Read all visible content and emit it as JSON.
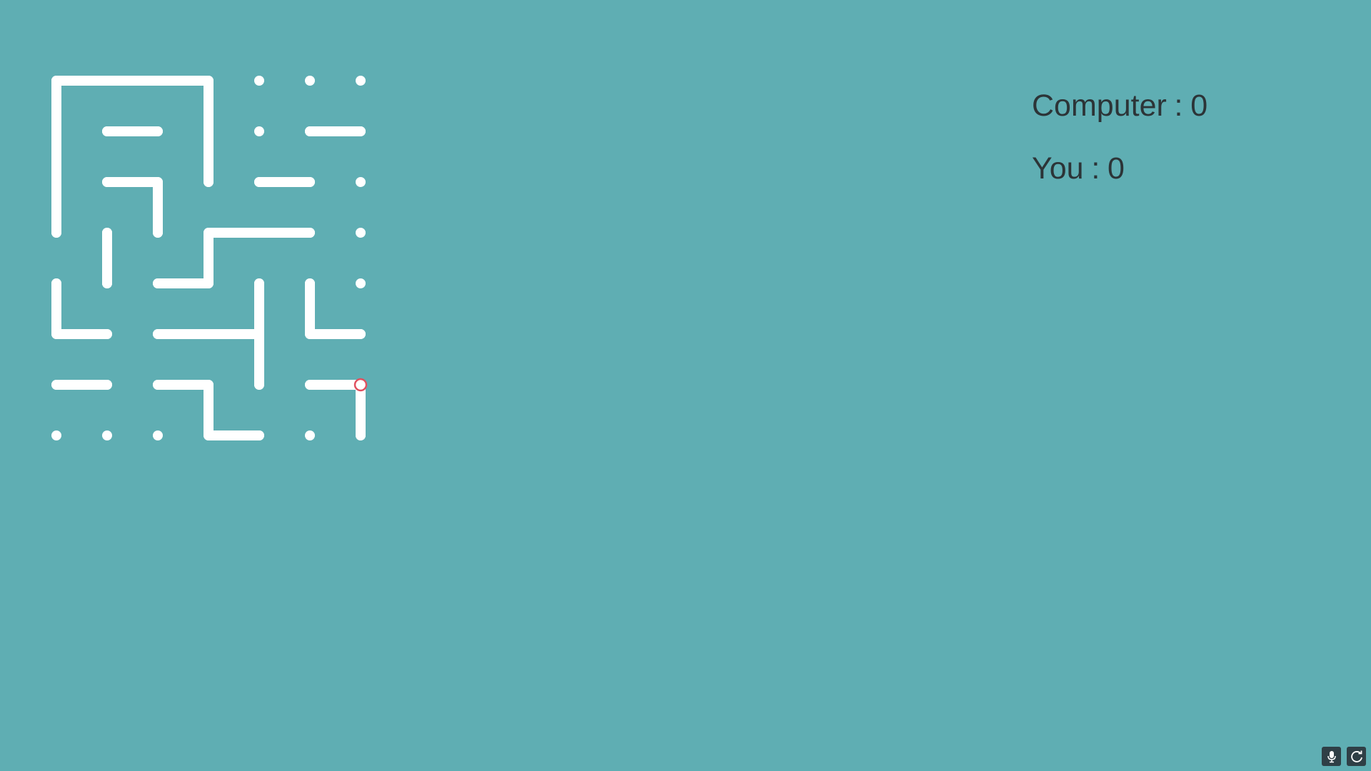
{
  "game": {
    "type": "maze-dots-and-lines",
    "grid": {
      "cols": 7,
      "rows": 8
    },
    "colors": {
      "background": "#5faeb3",
      "wall": "#ffffff",
      "player_marker": "#e0505f",
      "text": "#2c3437",
      "button": "#2f3f46"
    },
    "walls": [
      [
        [
          0,
          1
        ],
        [
          0,
          0
        ],
        [
          3,
          0
        ],
        [
          3,
          2
        ]
      ],
      [
        [
          1,
          1
        ],
        [
          2,
          1
        ]
      ],
      [
        [
          1,
          2
        ],
        [
          2,
          2
        ],
        [
          2,
          3
        ]
      ],
      [
        [
          4,
          2
        ],
        [
          5,
          2
        ]
      ],
      [
        [
          5,
          1
        ],
        [
          6,
          1
        ]
      ],
      [
        [
          1,
          3
        ],
        [
          1,
          4
        ]
      ],
      [
        [
          5,
          3
        ],
        [
          3,
          3
        ],
        [
          3,
          4
        ],
        [
          2,
          4
        ]
      ],
      [
        [
          0,
          4
        ],
        [
          0,
          5
        ],
        [
          1,
          5
        ]
      ],
      [
        [
          2,
          5
        ],
        [
          4,
          5
        ]
      ],
      [
        [
          4,
          4
        ],
        [
          4,
          6
        ]
      ],
      [
        [
          5,
          4
        ],
        [
          5,
          5
        ],
        [
          6,
          5
        ]
      ],
      [
        [
          0,
          6
        ],
        [
          1,
          6
        ]
      ],
      [
        [
          2,
          6
        ],
        [
          3,
          6
        ],
        [
          3,
          7
        ],
        [
          4,
          7
        ]
      ],
      [
        [
          5,
          6
        ],
        [
          6,
          6
        ],
        [
          6,
          7
        ]
      ],
      [
        [
          0,
          0
        ],
        [
          0,
          3
        ]
      ]
    ],
    "player": {
      "col": 6,
      "row": 6
    }
  },
  "scores": {
    "computer_label": "Computer",
    "computer_value": "0",
    "you_label": "You",
    "you_value": "0",
    "separator": ":"
  },
  "controls": {
    "mic_icon": "microphone-icon",
    "restart_icon": "restart-icon"
  }
}
